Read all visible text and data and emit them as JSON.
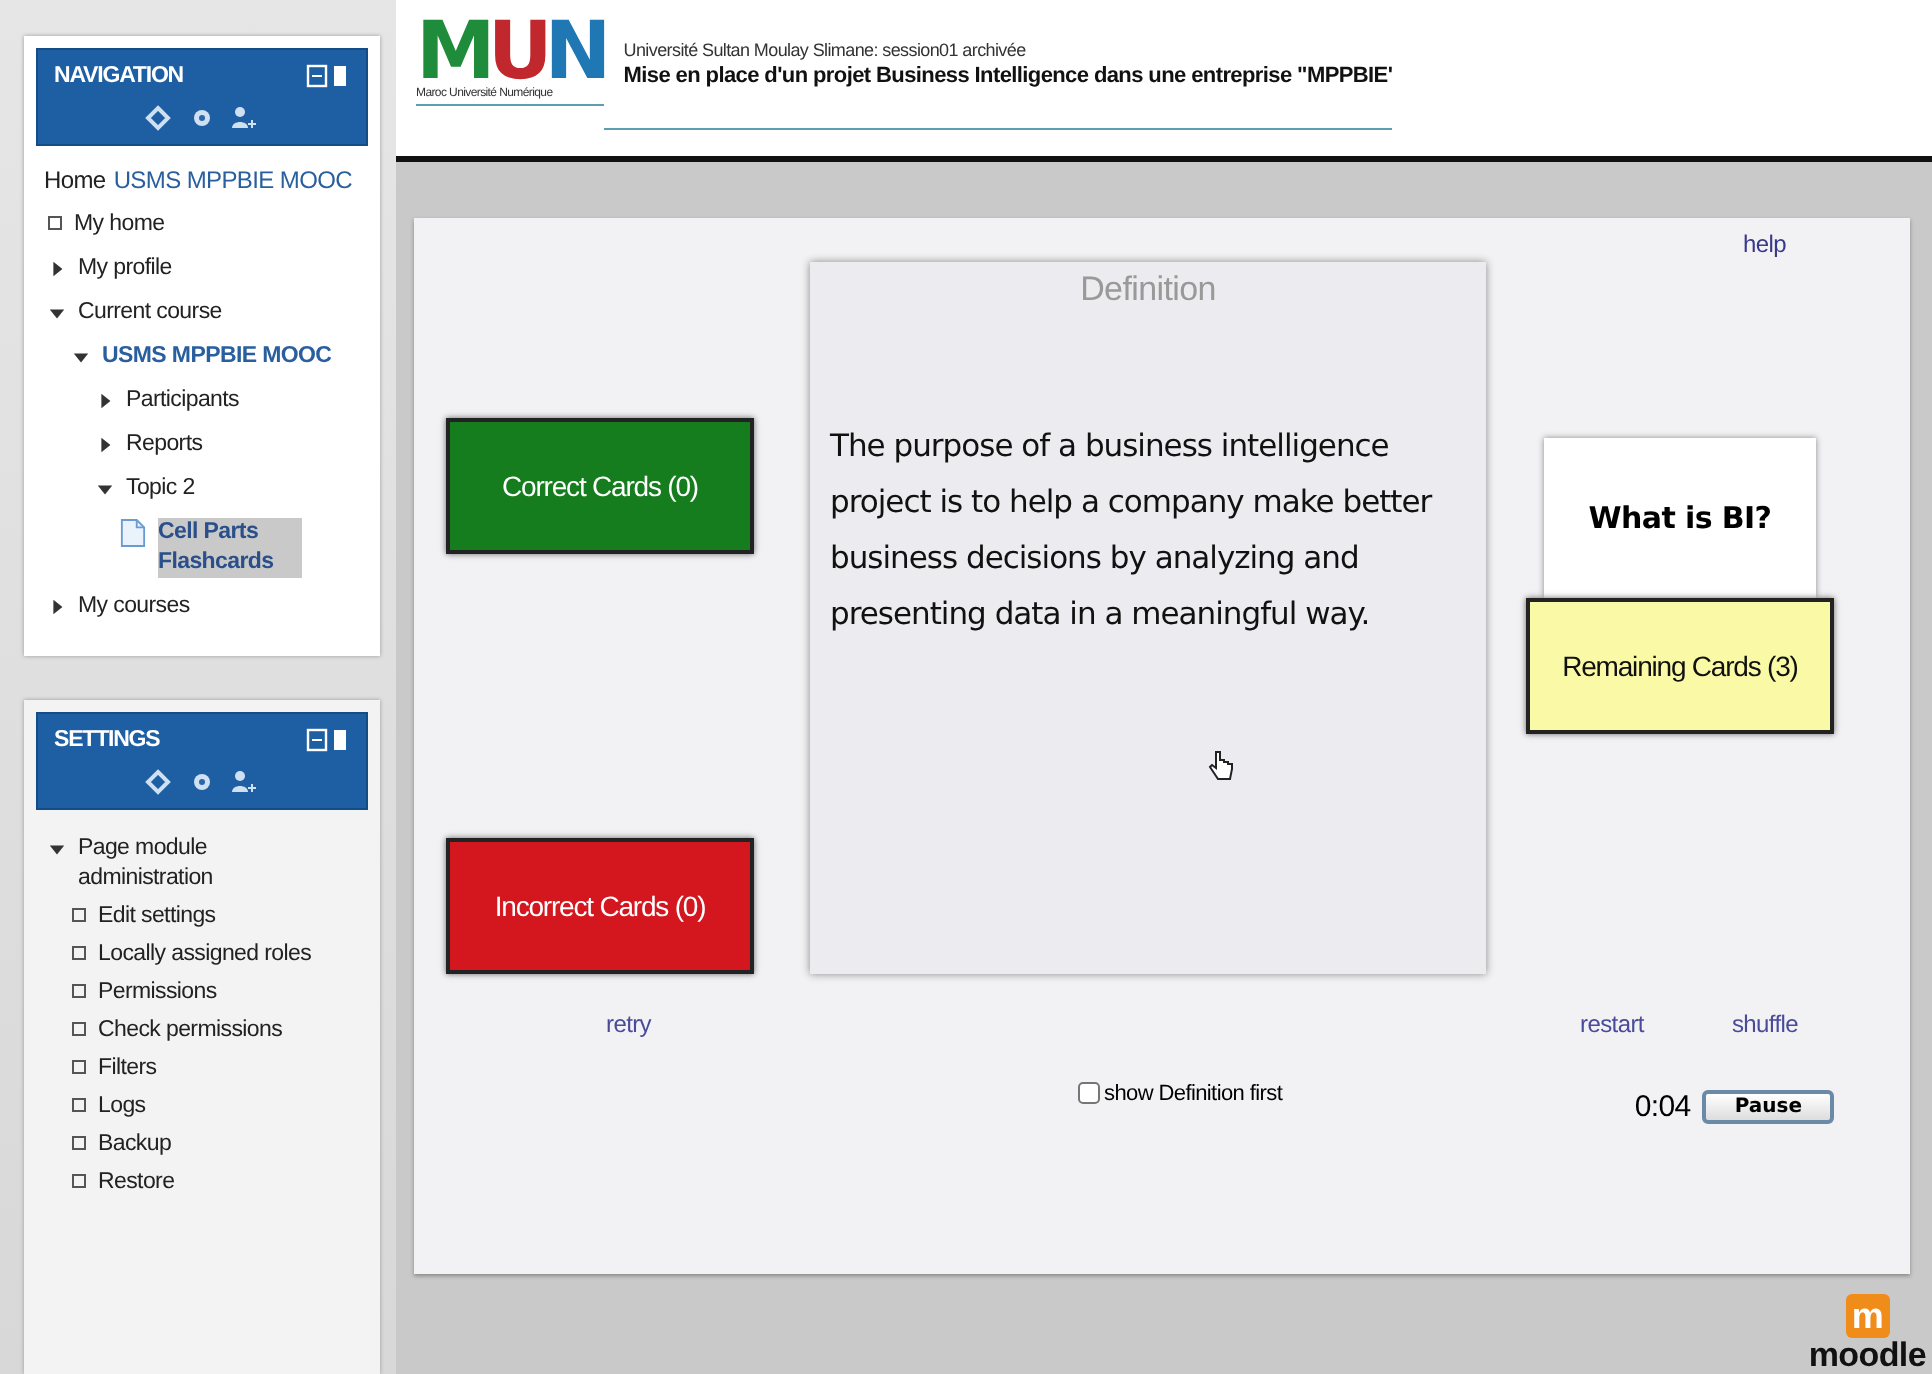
{
  "navigation": {
    "title": "NAVIGATION",
    "home": "Home",
    "home_link": "USMS MPPBIE MOOC",
    "items": [
      {
        "kind": "leaf",
        "label": "My home"
      },
      {
        "kind": "branch",
        "label": "My profile",
        "expanded": false
      },
      {
        "kind": "branch",
        "label": "Current course",
        "expanded": true,
        "children": [
          {
            "kind": "course",
            "label": "USMS MPPBIE MOOC",
            "expanded": true,
            "children": [
              {
                "kind": "branch",
                "label": "Participants",
                "expanded": false
              },
              {
                "kind": "branch",
                "label": "Reports",
                "expanded": false
              },
              {
                "kind": "branch",
                "label": "Topic 2",
                "expanded": true,
                "children": [
                  {
                    "kind": "page",
                    "label": "Cell Parts Flashcards"
                  }
                ]
              }
            ]
          }
        ]
      },
      {
        "kind": "branch",
        "label": "My courses",
        "expanded": false
      }
    ]
  },
  "settings": {
    "title": "SETTINGS",
    "items": [
      {
        "kind": "branch",
        "label": "Page module administration",
        "expanded": true,
        "children": [
          {
            "kind": "leaf",
            "label": "Edit settings"
          },
          {
            "kind": "leaf",
            "label": "Locally assigned roles"
          },
          {
            "kind": "leaf",
            "label": "Permissions"
          },
          {
            "kind": "leaf",
            "label": "Check permissions"
          },
          {
            "kind": "leaf",
            "label": "Filters"
          },
          {
            "kind": "leaf",
            "label": "Logs"
          },
          {
            "kind": "leaf",
            "label": "Backup"
          },
          {
            "kind": "leaf",
            "label": "Restore"
          }
        ]
      }
    ]
  },
  "header": {
    "logo_letters": [
      {
        "text": "M",
        "color": "#1e8c3a"
      },
      {
        "text": "U",
        "color": "#c0282d"
      },
      {
        "text": "N",
        "color": "#1f78b4"
      }
    ],
    "logo_caption": "Maroc Université Numérique",
    "site": "Université Sultan Moulay Slimane: session01 archivée",
    "course": "Mise en place d'un projet Business Intelligence dans une entreprise \"MPPBIE'"
  },
  "flashcards": {
    "help": "help",
    "correct": "Correct Cards (0)",
    "incorrect": "Incorrect Cards (0)",
    "card_title": "Definition",
    "card_text": "The purpose of a business intelligence project is to help a company make better business decisions by analyzing and presenting data in a meaningful way.",
    "next_card": "What is BI?",
    "remaining": "Remaining Cards (3)",
    "retry": "retry",
    "restart": "restart",
    "shuffle": "shuffle",
    "definition_first": {
      "label": "show Definition first",
      "checked": false
    },
    "timer": "0:04",
    "pause": "Pause"
  },
  "footer": {
    "logo_mark": "m",
    "logo_name": "moodle"
  }
}
